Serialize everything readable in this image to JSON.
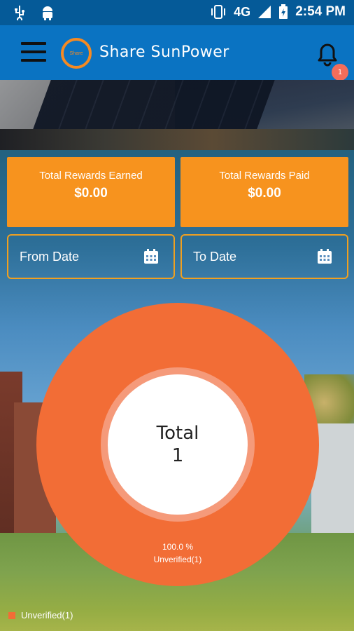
{
  "status_bar": {
    "time": "2:54 PM",
    "network": "4G"
  },
  "header": {
    "logo_text": "Share",
    "title": "Share SunPower",
    "notification_count": "1"
  },
  "rewards": {
    "earned_label": "Total Rewards Earned",
    "earned_value": "$0.00",
    "paid_label": "Total Rewards Paid",
    "paid_value": "$0.00"
  },
  "dates": {
    "from_label": "From Date",
    "to_label": "To Date"
  },
  "chart_data": {
    "type": "pie",
    "center_label": "Total",
    "center_value": "1",
    "slices": [
      {
        "name": "Unverified(1)",
        "value": 1,
        "percent": 100.0,
        "percent_label": "100.0 %",
        "color": "#f26d36"
      }
    ],
    "legend_label": "Unverified(1)"
  },
  "colors": {
    "accent": "#f7931e",
    "appbar": "#0a73c2",
    "statusbar": "#055a98",
    "donut": "#f26d36"
  }
}
